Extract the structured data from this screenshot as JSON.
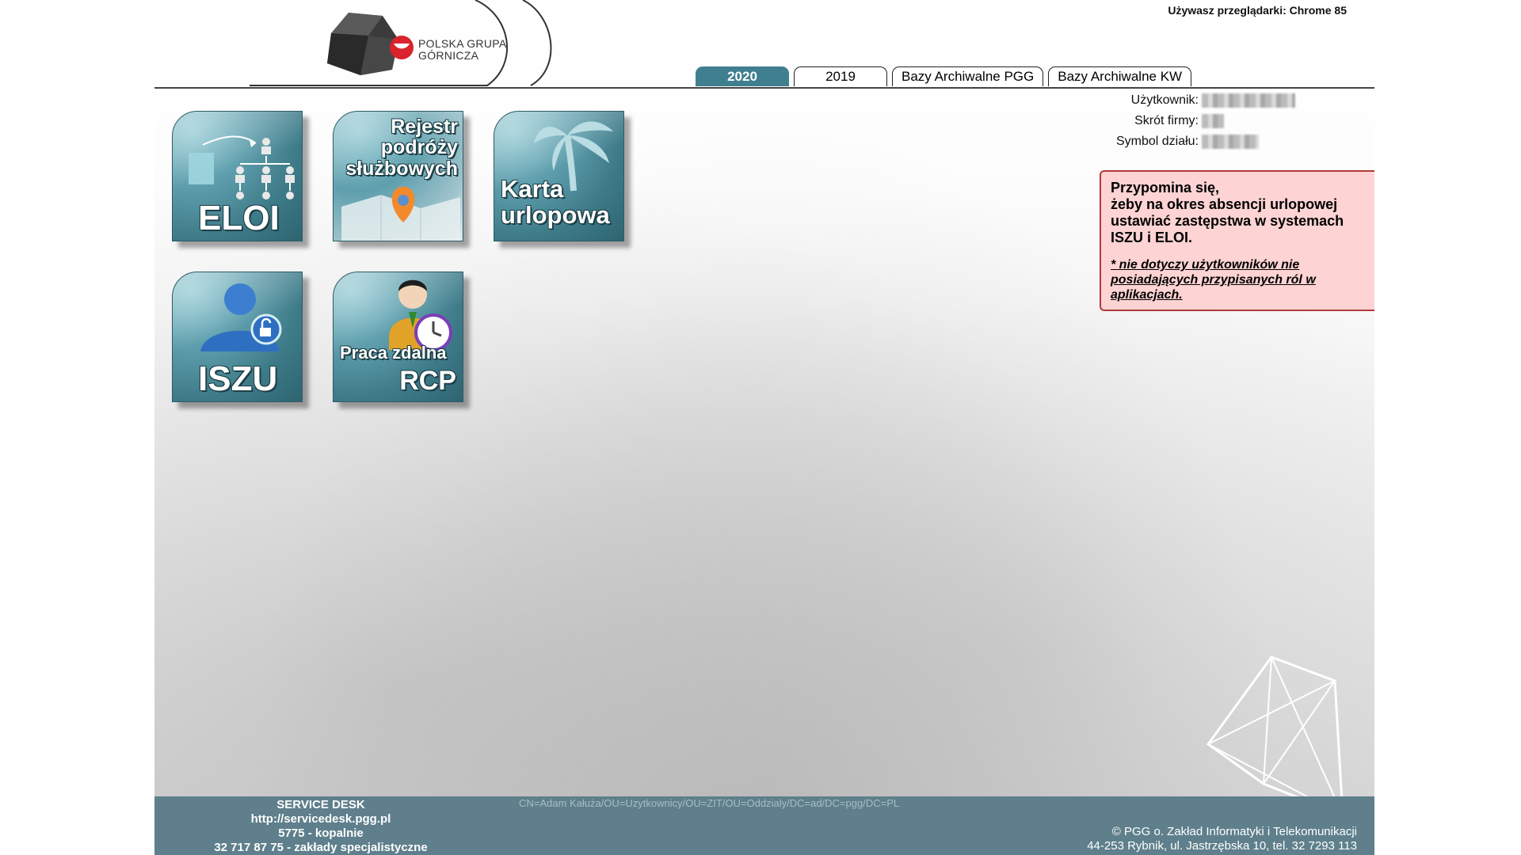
{
  "header": {
    "logo_line1": "POLSKA GRUPA",
    "logo_line2": "GÓRNICZA",
    "browser_info": "Używasz przeglądarki: Chrome 85"
  },
  "tabs": [
    {
      "label": "2020",
      "active": true
    },
    {
      "label": "2019",
      "active": false
    },
    {
      "label": "Bazy Archiwalne PGG",
      "active": false
    },
    {
      "label": "Bazy Archiwalne KW",
      "active": false
    }
  ],
  "user_info": {
    "user_label": "Użytkownik:",
    "company_label": "Skrót firmy:",
    "department_label": "Symbol działu:"
  },
  "reminder": {
    "title_line1": "Przypomina się,",
    "title_line2": "żeby na okres absencji urlopowej",
    "title_line3": "ustawiać zastępstwa w systemach",
    "title_line4": "ISZU i ELOI.",
    "note_line1": "* nie dotyczy użytkowników nie",
    "note_line2": "posiadających przypisanych ról w",
    "note_line3": "aplikacjach."
  },
  "tiles": {
    "eloi": {
      "label": "ELOI"
    },
    "rejestr": {
      "line1": "Rejestr",
      "line2": "podróży",
      "line3": "służbowych"
    },
    "karta": {
      "line1": "Karta",
      "line2": "urlopowa"
    },
    "iszu": {
      "label": "ISZU"
    },
    "praca": {
      "line1": "Praca zdalna",
      "line2": "RCP"
    }
  },
  "footer": {
    "service_desk_title": "SERVICE DESK",
    "service_desk_url": "http://servicedesk.pgg.pl",
    "phone_mines": "5775 - kopalnie",
    "phone_plants": "32 717 87 75 - zakłady specjalistyczne",
    "dn": "CN=Adam Kałuża/OU=Uzytkownicy/OU=ZIT/OU=Oddzialy/DC=ad/DC=pgg/DC=PL",
    "copyright_line1": "© PGG o. Zakład Informatyki i Telekomunikacji",
    "copyright_line2": "44-253 Rybnik, ul. Jastrzębska 10, tel. 32 7293 113"
  },
  "colors": {
    "accent": "#3f7f8f",
    "tile": "#5f9fad",
    "reminder_bg": "#fdd3d3",
    "reminder_border": "#b23a3a",
    "footer_bg": "#5e7f8b"
  }
}
